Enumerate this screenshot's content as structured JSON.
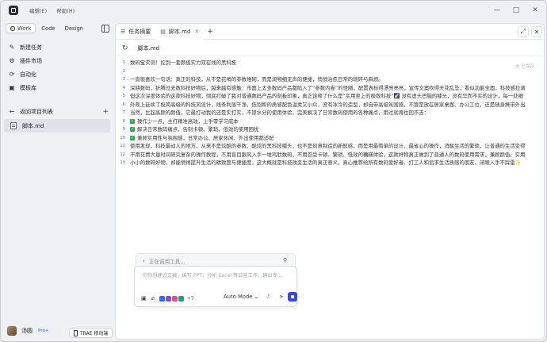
{
  "titlebar": {
    "menus": [
      "编辑(E)",
      "帮助(H)"
    ],
    "controls": [
      "—",
      "□",
      "✕"
    ]
  },
  "sidebar": {
    "mode_tabs": [
      "Work",
      "Code",
      "Design"
    ],
    "nav": [
      {
        "icon": "edit-icon",
        "glyph": "✎",
        "label": "新建任务"
      },
      {
        "icon": "puzzle-icon",
        "glyph": "⚙",
        "label": "插件市场"
      },
      {
        "icon": "automation-icon",
        "glyph": "⟳",
        "label": "自动化"
      },
      {
        "icon": "template-icon",
        "glyph": "▣",
        "label": "模板库"
      }
    ],
    "back_label": "返回项目列表",
    "files": [
      "脚本.md"
    ],
    "user": {
      "name": "汤圆",
      "badge": "Pro+"
    },
    "mobile_button": "TRAE 移动端"
  },
  "tabs": [
    {
      "label": "任务摘要",
      "active": false
    },
    {
      "label": "脚本.md",
      "active": true
    }
  ],
  "filebar": {
    "filename": "脚本.md"
  },
  "editor": {
    "save_hint": "未 已保存",
    "lines": [
      {
        "n": "1",
        "text": "数码宝实测！挖到一套颜值实力双在线的黑科技"
      },
      {
        "n": "2",
        "text": ""
      },
      {
        "n": "3",
        "text": "一直很喜欢一句话：真正的科技，从不是花哨的参数堆砌，而是润物细无声的便捷，悄悄治愈日常的琐碎与麻烦。"
      },
      {
        "n": "4",
        "text": "深耕数码，折腾过无数科技好物后，越来越有感触：市面上太多数码产品都陷入了“参数内卷”的怪圈，配置表标得漂亮亮亮，宣传文案吹得天花乱坠，看似功能全面，科技感拉满"
      },
      {
        "n": "5",
        "text": "但这次深度体验的这款科技好物，彻底打破了我对普通数码产品的刻板印象，真正诠释了什么是“实用至上的极致科技”🌠 没有虚头巴脑的噱头，没有华而不实的设计，每一处细"
      },
      {
        "n": "6",
        "text": "外观上延续了极简高级的科技风设计，线条利落干净，低饱和的质感配色温柔又小众，没有冰冷的造型，却自带高级氛围感，不管是放在居家桌面、办公工位，还是随身携带外出"
      },
      {
        "n": "7",
        "text": "当然，比起高颜的颜值，它最打动我的还是实打实，不掺水分的使用体验，完美解决了日常数码使用的各种痛点，用过就再也回不去："
      },
      {
        "n": "8",
        "text": "操作少一点，主打精准高效，上手零学习成本",
        "check": true
      },
      {
        "n": "9",
        "text": "解决日常数码痛点，告别卡顿、繁琐、低效的使用困扰",
        "check": true
      },
      {
        "n": "10",
        "text": "兼顾实用性与氛围感，日常办公、居家休闲、外出使用都适配",
        "check": true
      },
      {
        "n": "11",
        "text": "使用发现，科技最动人的地方，从来不是炫酷的参数、酷炫的黑科技噱头，也不是刻意制造的新鲜感，而是用最简单的设计、最省心的操作，消解生活的繁琐，让普通的生活变得"
      },
      {
        "n": "12",
        "text": "不用花费大量时间研究复杂的操作教程，不用盲目跟风入手一堆鸡肋数码，不用忍受卡顿、繁琐、低效的糟糕体验，这款好物真正做到了普通人的数码使用需求，兼顾颜值、实用"
      },
      {
        "n": "13",
        "text": "小小的数码好物，却能悄悄提升生活的精致度与便捷度，这大概就是科技改变生活的真正意义。真心推荐给所有数码爱好者、打工人和追求生活质感的朋友，闭眼入手不踩雷✨"
      }
    ]
  },
  "composer": {
    "status": "正在调用工具...",
    "placeholder": "你你想建设文稿，编写 PPT，分析 Excel 等日常工作，输出专...",
    "tool_count": "+7",
    "mode": "Auto Mode",
    "app_colors": [
      "#2f6cf6",
      "#7b4df2",
      "#e94a8b",
      "#1aa37a"
    ]
  }
}
